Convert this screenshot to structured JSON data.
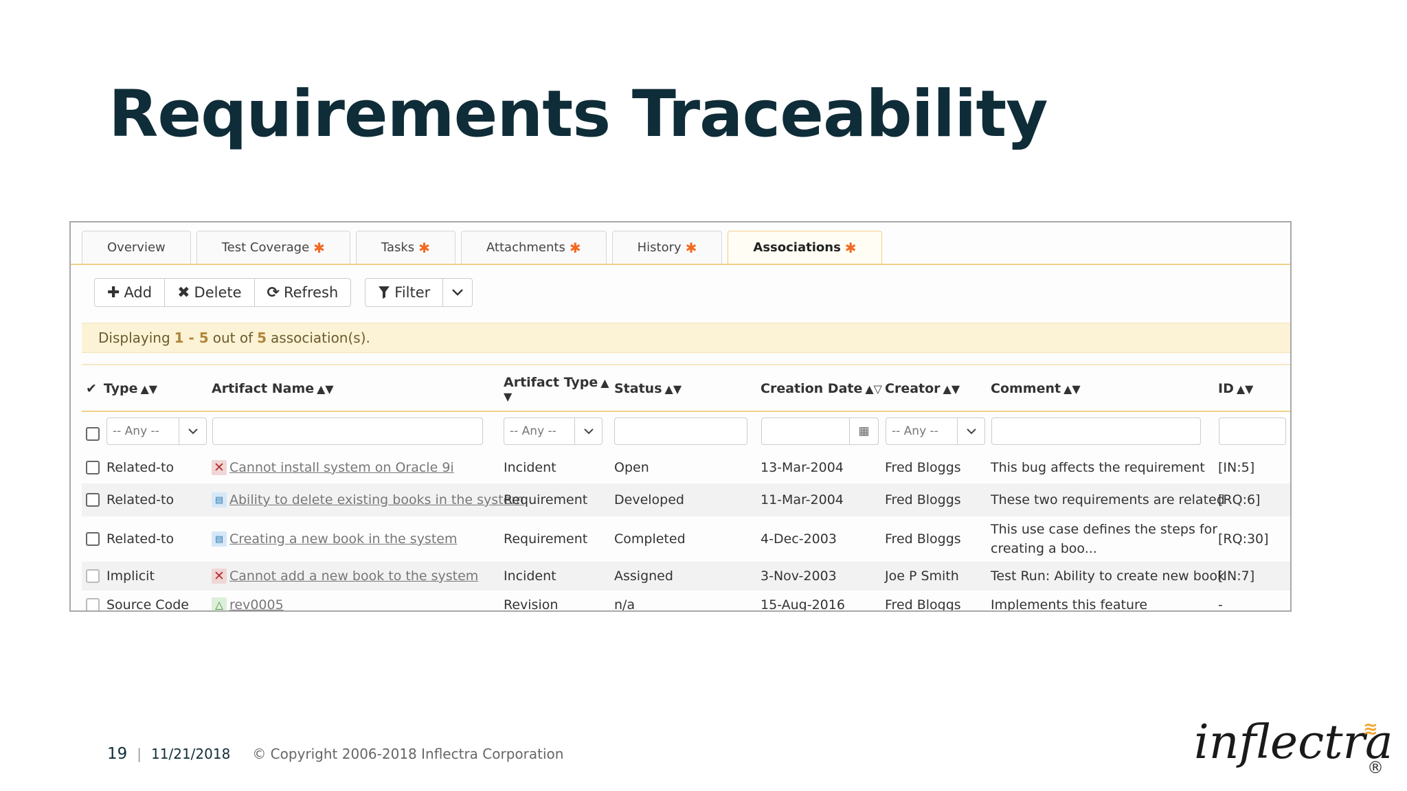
{
  "slide": {
    "title": "Requirements Traceability",
    "page_number": "19",
    "separator": "|",
    "date": "11/21/2018",
    "copyright": "© Copyright 2006-2018 Inflectra Corporation",
    "logo_text": "inflectra",
    "logo_reg": "®"
  },
  "tabs": [
    {
      "label": "Overview",
      "starred": false
    },
    {
      "label": "Test Coverage",
      "starred": true
    },
    {
      "label": "Tasks",
      "starred": true
    },
    {
      "label": "Attachments",
      "starred": true
    },
    {
      "label": "History",
      "starred": true
    },
    {
      "label": "Associations",
      "starred": true,
      "active": true
    }
  ],
  "star_glyph": "✱",
  "toolbar": {
    "add": "Add",
    "delete": "Delete",
    "refresh": "Refresh",
    "filter": "Filter"
  },
  "banner": {
    "prefix": "Displaying",
    "range": "1 - 5",
    "middle": "out of",
    "total": "5",
    "suffix": "association(s)."
  },
  "columns": {
    "type": "Type",
    "artifact_name": "Artifact Name",
    "artifact_type": "Artifact Type",
    "status": "Status",
    "creation_date": "Creation Date",
    "creator": "Creator",
    "comment": "Comment",
    "id": "ID"
  },
  "filters": {
    "type": "-- Any --",
    "artifact_type": "-- Any --",
    "creator": "-- Any --"
  },
  "rows": [
    {
      "type": "Related-to",
      "name": "Cannot install system on Oracle 9i",
      "icon": "incident-icon",
      "artifact_type": "Incident",
      "status": "Open",
      "date": "13-Mar-2004",
      "creator": "Fred Bloggs",
      "comment": "This bug affects the requirement",
      "comment2": "",
      "id": "[IN:5]"
    },
    {
      "type": "Related-to",
      "name": "Ability to delete existing books in the system",
      "icon": "requirement-icon",
      "artifact_type": "Requirement",
      "status": "Developed",
      "date": "11-Mar-2004",
      "creator": "Fred Bloggs",
      "comment": "These two requirements are related",
      "comment2": "",
      "id": "[RQ:6]"
    },
    {
      "type": "Related-to",
      "name": "Creating a new book in the system",
      "icon": "requirement-icon",
      "artifact_type": "Requirement",
      "status": "Completed",
      "date": "4-Dec-2003",
      "creator": "Fred Bloggs",
      "comment": "This use case defines the steps for",
      "comment2": "creating a boo...",
      "id": "[RQ:30]"
    },
    {
      "type": "Implicit",
      "name": "Cannot add a new book to the system",
      "icon": "incident-icon",
      "artifact_type": "Incident",
      "status": "Assigned",
      "date": "3-Nov-2003",
      "creator": "Joe P Smith",
      "comment": "Test Run: Ability to create new book",
      "comment2": "",
      "id": "[IN:7]"
    },
    {
      "type": "Source Code",
      "name": "rev0005",
      "icon": "revision-icon",
      "artifact_type": "Revision",
      "status": "n/a",
      "date": "15-Aug-2016",
      "creator": "Fred Bloggs",
      "comment": "Implements this feature",
      "comment2": "",
      "id": "-"
    }
  ],
  "colors": {
    "title": "#0f2d38",
    "accent_star": "#f26a22",
    "banner_bg": "#fcf3d6",
    "tab_active_border": "#f0cf87",
    "logo_wave": "#f2a531"
  }
}
